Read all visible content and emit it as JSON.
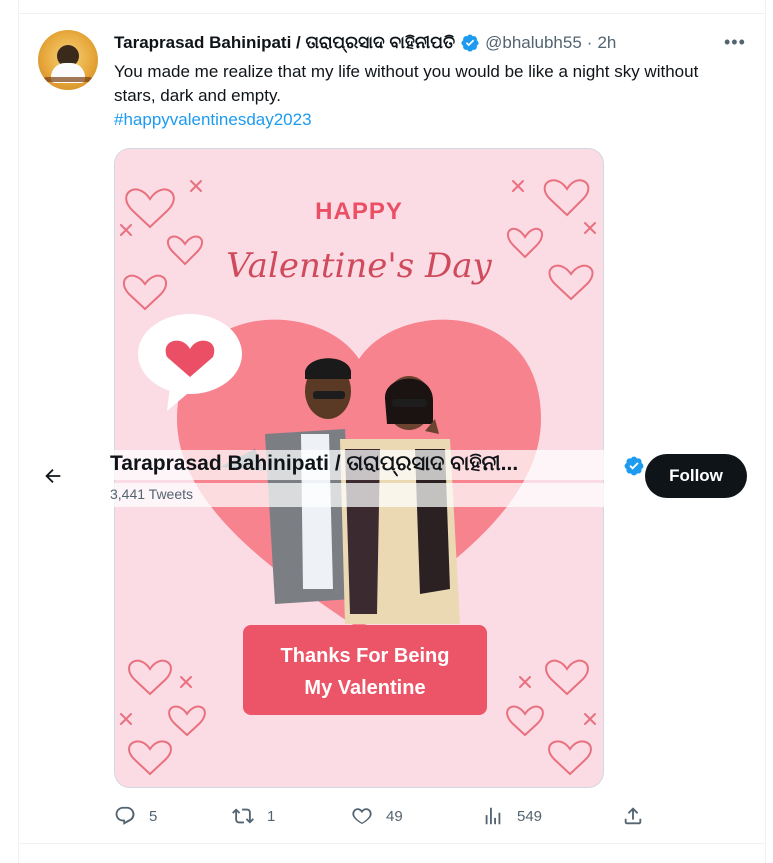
{
  "tweet": {
    "author_name": "Taraprasad Bahinipati / ତାରାପ୍ରସାଦ ବାହିନୀପତି",
    "handle": "@bhalubh55",
    "separator": "·",
    "time": "2h",
    "more_label": "•••",
    "text": "You made me realize that my life without you would be like a night sky without stars, dark and empty.",
    "hashtag": "#happyvalentinesday2023",
    "avatar_icon": "profile-photo",
    "verified_icon": "verified-badge-icon",
    "accent_color": "#1d9bf0"
  },
  "media": {
    "title_line1": "HAPPY",
    "title_line2": "Valentine's Day",
    "banner_line1": "Thanks For Being",
    "banner_line2": "My Valentine",
    "colors": {
      "background": "#fcdce4",
      "heart": "#f7838f",
      "accent": "#ea4f66",
      "banner": "#ec5468"
    }
  },
  "profile_bar": {
    "name": "Taraprasad Bahinipati / ତାରାପ୍ରସାଦ ବାହିନୀ...",
    "tweet_count": "3,441 Tweets",
    "follow_label": "Follow",
    "back_icon": "arrow-left-icon"
  },
  "actions": {
    "reply_count": "5",
    "retweet_count": "1",
    "like_count": "49",
    "views_count": "549",
    "icons": [
      "reply-icon",
      "retweet-icon",
      "like-icon",
      "views-icon",
      "share-icon"
    ]
  }
}
